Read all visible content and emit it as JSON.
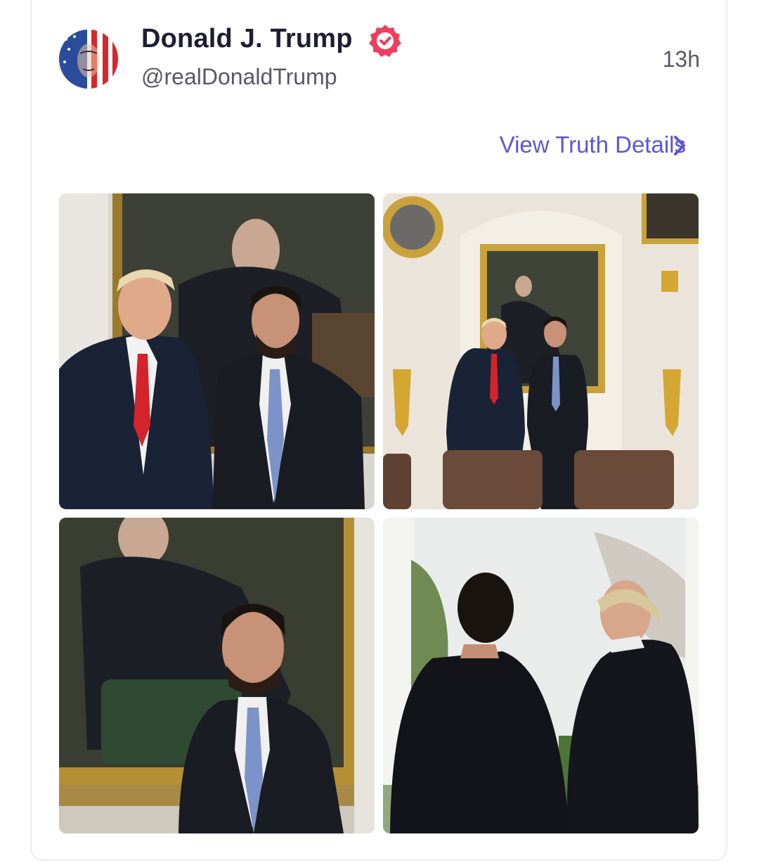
{
  "post": {
    "author": {
      "display_name": "Donald J. Trump",
      "handle": "@realDonaldTrump",
      "verified": true,
      "avatar_icon": "flag-portrait-avatar"
    },
    "timestamp": "13h",
    "view_details_label": "View Truth Details",
    "photos": [
      {
        "icon": "photo-two-men-in-front-of-portrait"
      },
      {
        "icon": "photo-two-men-in-formal-room"
      },
      {
        "icon": "photo-man-in-front-of-portrait"
      },
      {
        "icon": "photo-two-men-by-window"
      }
    ]
  },
  "colors": {
    "accent": "#5f55d6",
    "verified_badge": "#ef3e5d",
    "name_text": "#1f1d33",
    "secondary_text": "#595765"
  }
}
